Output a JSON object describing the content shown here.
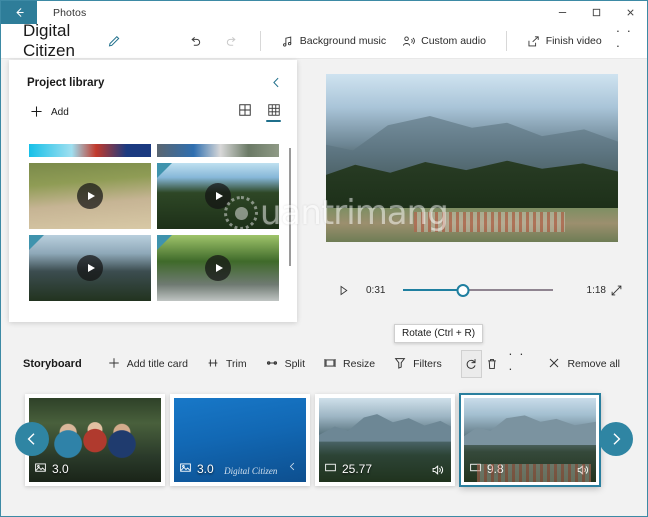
{
  "window": {
    "app_name": "Photos",
    "back_icon": "back-arrow-icon",
    "minimize_icon": "minimize-icon",
    "maximize_icon": "maximize-icon",
    "close_icon": "close-icon"
  },
  "commandbar": {
    "project_title": "Digital Citizen",
    "edit_icon": "pencil-icon",
    "undo_icon": "undo-icon",
    "redo_icon": "redo-icon",
    "background_music": "Background music",
    "background_music_icon": "music-note-icon",
    "custom_audio": "Custom audio",
    "custom_audio_icon": "person-audio-icon",
    "finish_video": "Finish video",
    "finish_video_icon": "export-icon",
    "overflow": "· · ·"
  },
  "library": {
    "title": "Project library",
    "collapse_icon": "chevron-left-icon",
    "add_label": "Add",
    "add_icon": "plus-icon",
    "view_large_icon": "grid-large-icon",
    "view_small_icon": "grid-small-icon",
    "selected_view": "grid-small",
    "thumbnails": [
      {
        "name": "playground",
        "fill": "img-playground",
        "play": true,
        "corner": false
      },
      {
        "name": "forest",
        "fill": "img-forest",
        "play": true,
        "corner": true
      },
      {
        "name": "mountain",
        "fill": "img-mountain-dark",
        "play": true,
        "corner": true
      },
      {
        "name": "road",
        "fill": "img-road",
        "play": true,
        "corner": true
      }
    ],
    "clipped_top_row": [
      {
        "name": "cyan-strip",
        "fill": "img-cyan-strip"
      },
      {
        "name": "street-strip",
        "fill": "img-street-strip"
      }
    ]
  },
  "preview": {
    "play_icon": "play-icon",
    "current_time": "0:31",
    "total_time": "1:18",
    "expand_icon": "fullscreen-icon",
    "progress_percent": 40
  },
  "storyboard": {
    "label": "Storyboard",
    "items": [
      {
        "label": "Add title card",
        "icon": "plus-icon"
      },
      {
        "label": "Trim",
        "icon": "trim-icon"
      },
      {
        "label": "Split",
        "icon": "split-icon"
      },
      {
        "label": "Resize",
        "icon": "resize-icon"
      },
      {
        "label": "Filters",
        "icon": "filters-icon"
      }
    ],
    "rotate_icon": "rotate-icon",
    "delete_icon": "trash-icon",
    "overflow": "· · ·",
    "remove_all": "Remove all",
    "remove_all_icon": "close-x-icon",
    "tooltip": "Rotate (Ctrl + R)",
    "nav_left_icon": "chevron-left-icon",
    "nav_right_icon": "chevron-right-icon",
    "clips": [
      {
        "name": "bikers-photo",
        "duration": "3.0",
        "type_icon": "photo-icon",
        "fill": "img-bikers",
        "audio": false,
        "selected": false,
        "title_text": ""
      },
      {
        "name": "title-card",
        "duration": "3.0",
        "type_icon": "photo-icon",
        "fill": "img-titlecard",
        "audio": false,
        "selected": false,
        "title_text": "Digital Citizen"
      },
      {
        "name": "mountain-video-1",
        "duration": "25.77",
        "type_icon": "video-icon",
        "fill": "img-mount1",
        "audio": true,
        "selected": false,
        "title_text": ""
      },
      {
        "name": "mountain-video-2",
        "duration": "9.8",
        "type_icon": "video-icon",
        "fill": "img-mount2",
        "audio": true,
        "selected": true,
        "title_text": ""
      }
    ]
  },
  "watermark": {
    "text": "uantrimang",
    "icon": "sun-icon"
  },
  "colors": {
    "accent": "#2e7d99",
    "accent_link": "#1f6f8b",
    "slider": "#1f7fa0",
    "selection": "#2a7f9e",
    "titlecard_blue": "#1268b4"
  }
}
